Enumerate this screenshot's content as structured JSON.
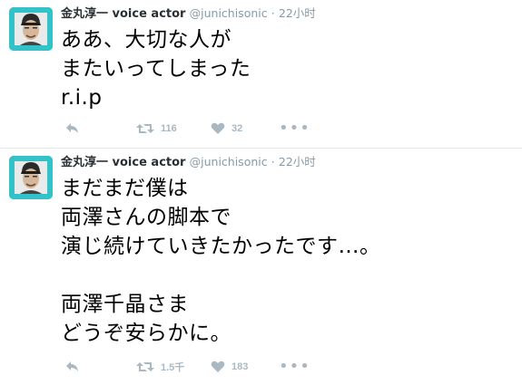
{
  "tweets": [
    {
      "fullname": "金丸淳一 voice actor",
      "username": "@junichisonic",
      "separator": "·",
      "time": "22小时",
      "text_lines": [
        "ああ、大切な人が",
        "またいってしまった",
        "r.i.p"
      ],
      "reply_label": "",
      "retweet_count": "116",
      "like_count": "32",
      "more_label": "•••"
    },
    {
      "fullname": "金丸淳一 voice actor",
      "username": "@junichisonic",
      "separator": "·",
      "time": "22小时",
      "text_lines": [
        "まだまだ僕は",
        "両澤さんの脚本で",
        "演じ続けていきたかったです…。",
        "",
        "両澤千晶さま",
        "どうぞ安らかに。"
      ],
      "reply_label": "",
      "retweet_count": "1.5千",
      "like_count": "183",
      "more_label": "•••"
    }
  ],
  "colors": {
    "avatar_bg": "#33c2c8",
    "name": "#292f33",
    "meta": "#8899a6",
    "action_icon": "#aab8c2",
    "divider": "#e1e8ed"
  }
}
